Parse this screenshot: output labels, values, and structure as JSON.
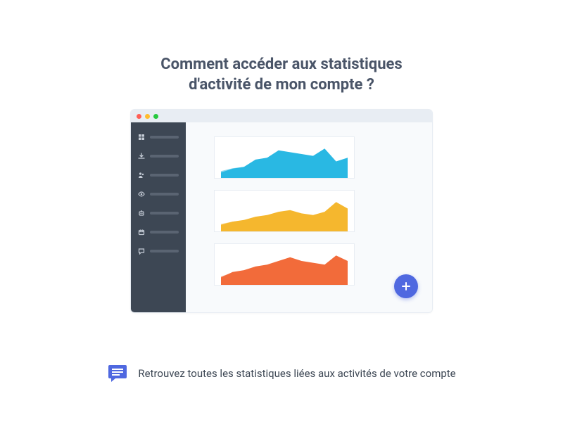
{
  "title_line1": "Comment accéder aux statistiques",
  "title_line2": "d'activité de mon compte ?",
  "footer_text": "Retrouvez toutes les statistiques liées aux activités de votre compte",
  "sidebar": {
    "items": [
      {
        "icon": "grid"
      },
      {
        "icon": "download"
      },
      {
        "icon": "users"
      },
      {
        "icon": "eye"
      },
      {
        "icon": "robot"
      },
      {
        "icon": "calendar"
      },
      {
        "icon": "chat"
      }
    ]
  },
  "chart_data": [
    {
      "type": "area",
      "color": "#29b8e3",
      "light": "#8bd8ee",
      "values": [
        6,
        10,
        12,
        20,
        22,
        30,
        28,
        26,
        24,
        32,
        18,
        22
      ]
    },
    {
      "type": "area",
      "color": "#f5b72e",
      "light": "#f9d68a",
      "values": [
        8,
        12,
        14,
        18,
        20,
        24,
        26,
        22,
        20,
        24,
        36,
        28
      ]
    },
    {
      "type": "area",
      "color": "#f26b3a",
      "light": "#f8a98a",
      "values": [
        8,
        14,
        16,
        20,
        22,
        26,
        30,
        26,
        24,
        22,
        32,
        26
      ]
    }
  ],
  "colors": {
    "fab": "#4f68e0",
    "sidebar": "#3d4754"
  }
}
